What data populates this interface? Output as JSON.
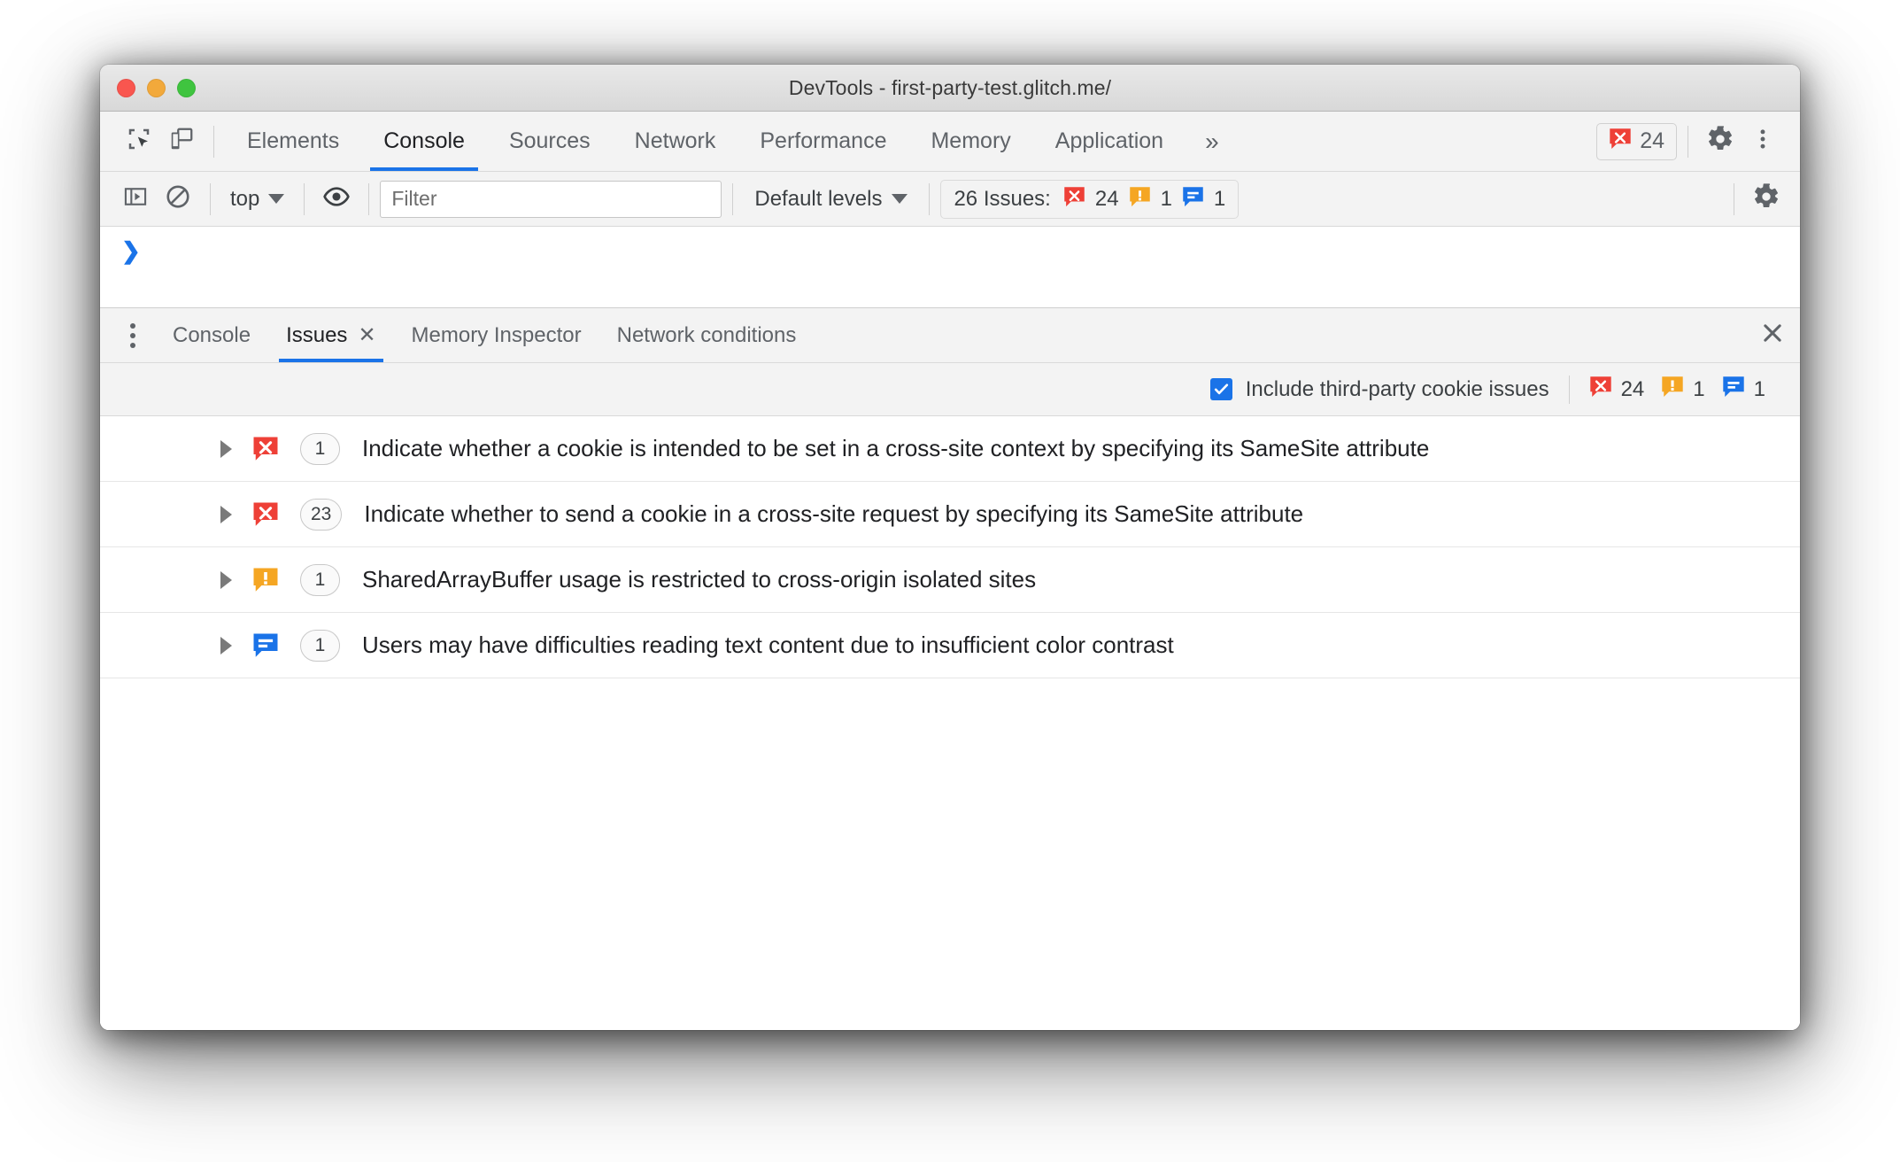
{
  "window": {
    "title": "DevTools - first-party-test.glitch.me/",
    "traffic_lights": [
      "close",
      "minimize",
      "maximize"
    ]
  },
  "main_toolbar": {
    "inspect_icon": "inspect-element-icon",
    "device_icon": "device-toolbar-icon",
    "tabs": [
      {
        "label": "Elements",
        "active": false
      },
      {
        "label": "Console",
        "active": true
      },
      {
        "label": "Sources",
        "active": false
      },
      {
        "label": "Network",
        "active": false
      },
      {
        "label": "Performance",
        "active": false
      },
      {
        "label": "Memory",
        "active": false
      },
      {
        "label": "Application",
        "active": false
      }
    ],
    "more_tabs_label": "»",
    "error_badge": {
      "icon": "error-icon",
      "count": "24"
    },
    "settings_icon": "gear-icon",
    "menu_icon": "kebab-menu-icon"
  },
  "console_toolbar": {
    "sidebar_toggle_icon": "console-sidebar-icon",
    "clear_icon": "clear-console-icon",
    "context": "top",
    "eye_icon": "live-expression-eye-icon",
    "filter_placeholder": "Filter",
    "filter_value": "",
    "levels": "Default levels",
    "issues_label": "26 Issues:",
    "issues_counts": {
      "errors": "24",
      "warnings": "1",
      "info": "1"
    },
    "settings_icon": "gear-icon"
  },
  "console_body": {
    "prompt": "❯"
  },
  "drawer": {
    "kebab_icon": "drawer-more-options-icon",
    "tabs": [
      {
        "label": "Console",
        "active": false,
        "closable": false
      },
      {
        "label": "Issues",
        "active": true,
        "closable": true
      },
      {
        "label": "Memory Inspector",
        "active": false,
        "closable": false
      },
      {
        "label": "Network conditions",
        "active": false,
        "closable": false
      }
    ],
    "close_icon": "close-drawer-icon",
    "close_label": "✕",
    "tab_close_label": "✕"
  },
  "issues_bar": {
    "checkbox_checked": true,
    "checkbox_label": "Include third-party cookie issues",
    "counts": {
      "errors": "24",
      "warnings": "1",
      "info": "1"
    }
  },
  "issues": [
    {
      "severity": "error",
      "count": "1",
      "text": "Indicate whether a cookie is intended to be set in a cross-site context by specifying its SameSite attribute"
    },
    {
      "severity": "error",
      "count": "23",
      "text": "Indicate whether to send a cookie in a cross-site request by specifying its SameSite attribute"
    },
    {
      "severity": "warning",
      "count": "1",
      "text": "SharedArrayBuffer usage is restricted to cross-origin isolated sites"
    },
    {
      "severity": "info",
      "count": "1",
      "text": "Users may have difficulties reading text content due to insufficient color contrast"
    }
  ],
  "colors": {
    "error_red": "#ee4037",
    "warning_orange": "#f5a623",
    "info_blue": "#1a73e8",
    "accent_blue": "#1a73e8",
    "toolbar_bg": "#f3f3f3",
    "titlebar_bg": "#e2e2e2"
  }
}
